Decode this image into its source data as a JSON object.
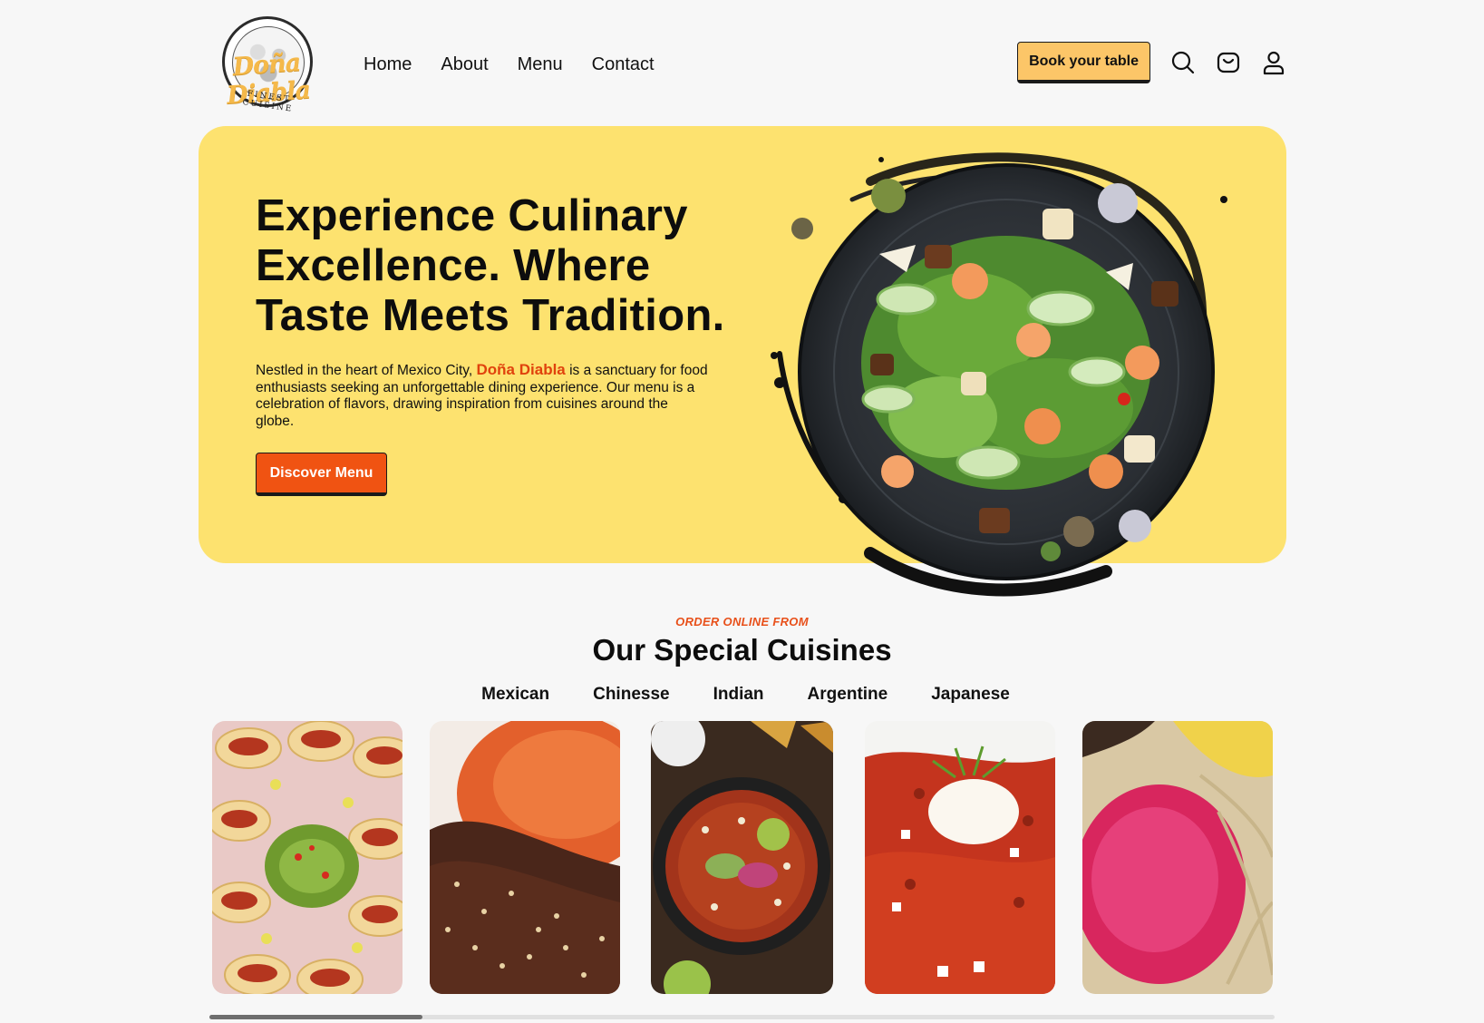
{
  "header": {
    "logo_script": "Doña Diabla",
    "logo_sub": "FINEST CUISINE",
    "nav": [
      {
        "label": "Home"
      },
      {
        "label": "About"
      },
      {
        "label": "Menu"
      },
      {
        "label": "Contact"
      }
    ],
    "book_label": "Book your table",
    "icons": [
      "search-icon",
      "cart-icon",
      "user-icon"
    ]
  },
  "hero": {
    "title": "Experience Culinary Excellence. Where Taste Meets Tradition.",
    "text_before": "Nestled in the heart of Mexico City, ",
    "brand": "Doña Diabla",
    "text_after": " is a sanctuary for food enthusiasts seeking an unforgettable dining experience. Our menu is a celebration of flavors, drawing inspiration from cuisines around the globe.",
    "button_label": "Discover Menu"
  },
  "cuisines": {
    "kicker": "ORDER ONLINE FROM",
    "title": "Our Special Cuisines",
    "tabs": [
      {
        "label": "Mexican"
      },
      {
        "label": "Chinesse"
      },
      {
        "label": "Indian"
      },
      {
        "label": "Argentine"
      },
      {
        "label": "Japanese"
      }
    ],
    "scroll_position": 0.2
  },
  "colors": {
    "hero_bg": "#fde26f",
    "accent_orange": "#f05312",
    "book_button": "#fcc668",
    "page_bg": "#f7f7f7"
  }
}
